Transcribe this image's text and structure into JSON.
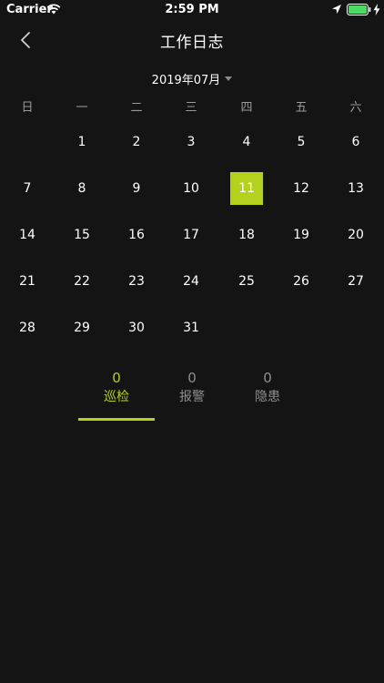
{
  "status_bar": {
    "carrier": "Carrier",
    "time": "2:59 PM",
    "battery_color": "#4cd964"
  },
  "nav": {
    "title": "工作日志"
  },
  "calendar": {
    "month_label": "2019年07月",
    "weekdays": [
      "日",
      "一",
      "二",
      "三",
      "四",
      "五",
      "六"
    ],
    "first_weekday_index": 1,
    "days_in_month": 31,
    "selected_day": "11",
    "days": [
      "1",
      "2",
      "3",
      "4",
      "5",
      "6",
      "7",
      "8",
      "9",
      "10",
      "11",
      "12",
      "13",
      "14",
      "15",
      "16",
      "17",
      "18",
      "19",
      "20",
      "21",
      "22",
      "23",
      "24",
      "25",
      "26",
      "27",
      "28",
      "29",
      "30",
      "31"
    ]
  },
  "tabs": [
    {
      "count": "0",
      "label": "巡检",
      "active": true
    },
    {
      "count": "0",
      "label": "报警",
      "active": false
    },
    {
      "count": "0",
      "label": "隐患",
      "active": false
    }
  ],
  "colors": {
    "accent": "#b3d11d",
    "background": "#141414",
    "muted": "#8f8f8f"
  }
}
